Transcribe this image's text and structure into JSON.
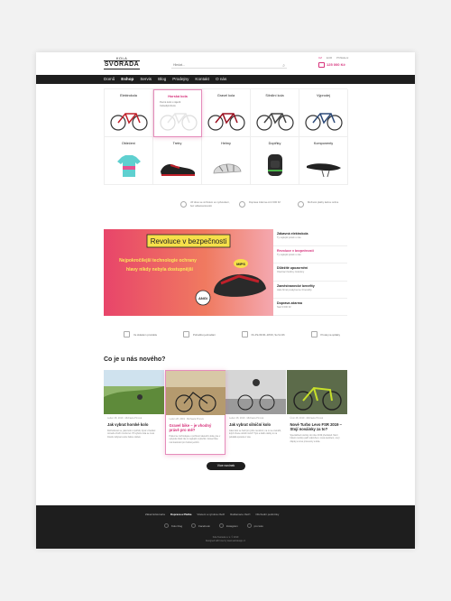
{
  "header": {
    "logo_small": "KOLA",
    "logo_big": "SVORADA",
    "search_placeholder": "Hledat...",
    "lang_1": "CZ",
    "lang_2": "EUR",
    "login": "Přihlášení",
    "cart_price": "125 000 Kč"
  },
  "nav": {
    "items": [
      "Domů",
      "Eshop",
      "Servis",
      "Blog",
      "Prodejny",
      "Kontakt",
      "O nás"
    ]
  },
  "categories": [
    {
      "label": "Elektrokola"
    },
    {
      "label": "Horská kola",
      "sub": [
        "Pevné kolo s nájezd.",
        "Celoodpružená"
      ]
    },
    {
      "label": "Gravel kola"
    },
    {
      "label": "Silniční kola"
    },
    {
      "label": "Výprodej"
    },
    {
      "label": "Oblečení"
    },
    {
      "label": "Tretry"
    },
    {
      "label": "Helmy"
    },
    {
      "label": "Doplňky"
    },
    {
      "label": "Komponenty"
    }
  ],
  "usp_top": [
    "Již dnes se vrcholem ve vyzkoušení, bez odkamenkování",
    "Doprava zdarma od 2 000 Kč",
    "Možnost platby kartou online"
  ],
  "banner": {
    "headline": "Revoluce v bezpečnosti",
    "text_1": "Nejpokročilejší technologie ochrany",
    "text_2": "hlavy nikdy nebyla dostupnější",
    "brand": "MIPS",
    "tag": "ANGi"
  },
  "banner_side": [
    {
      "title": "Zábavná elektrokola",
      "sub": "Ty nejlepší právě u nás"
    },
    {
      "title": "Revoluce v bezpečnosti",
      "sub": "Ty nejlepší právě u nás"
    },
    {
      "title": "Důležité upozornění",
      "sub": "Otevírací hodiny změněny"
    },
    {
      "title": "Zaměstnanecké benefity",
      "sub": "Jako firmě poskytneme 3 benefity"
    },
    {
      "title": "Doprava zdarma",
      "sub": "Nad 3 000 Kč"
    }
  ],
  "usp_bottom": [
    "Ve skladem produktu",
    "Pohodlné jednodání",
    "Po-Pá 09:00–18:00, So 9-13h",
    "Prodej na splátky"
  ],
  "news": {
    "title": "Co je u nás nového?",
    "more": "Více novinek",
    "items": [
      {
        "meta": "Leden 28, 2019 · Michaela Pínová",
        "title": "Jak vybrat horské kolo",
        "desc": "Rozhodnout se, jaké kolo si pořídit, bývá v hledání rozsahu zboží mnoho let. Při výběru kola se musí člověk zabývat celou řadou otázek."
      },
      {
        "meta": "Leden 28, 2019 · Michaela Pínová",
        "title": "Gravel bike – je vhodný právě pro mě?",
        "desc": "Pokud se rozhodujete o pořízení takového kola, jste v uplynulé části zde to nejlepší si přečíst. Gravel bike má vlastnosti pro hodně jezdců."
      },
      {
        "meta": "Leden 28, 2019 · Michaela Pínová",
        "title": "Jak vybrat silniční kolo",
        "desc": "Jaké kolo se hodí pro jízdu na silnici, na co se zaměřit, když chcete silniční kolo? Tyto a další otázky si na pokládá spousta z vás."
      },
      {
        "meta": "Únor 28, 2019 · Michaela Pínová",
        "title": "Nové Turbo Levo FSR 2019 – Stojí nováinky za to?",
        "desc": "Specialized novinky do roku 2019 představil. Mezi hlavní novinky patří odpružení, nová osvětlení, nový displej a nové procesory a kola."
      }
    ]
  },
  "footer": {
    "links": [
      "Zákaznická karta",
      "Doprava a Platba",
      "Vrácení a výměna zboží",
      "Reklamace zboží",
      "Obchodní podmínky"
    ],
    "social": [
      "Kolo blog",
      "Facebook",
      "Instagram",
      "pro kolo"
    ],
    "copy_1": "Kola Svorada s.r.o. © 2019",
    "copy_2": "Designed with love by www.webdesign.cz"
  },
  "colors": {
    "accent": "#d6307a",
    "dark": "#1e1e1e"
  }
}
